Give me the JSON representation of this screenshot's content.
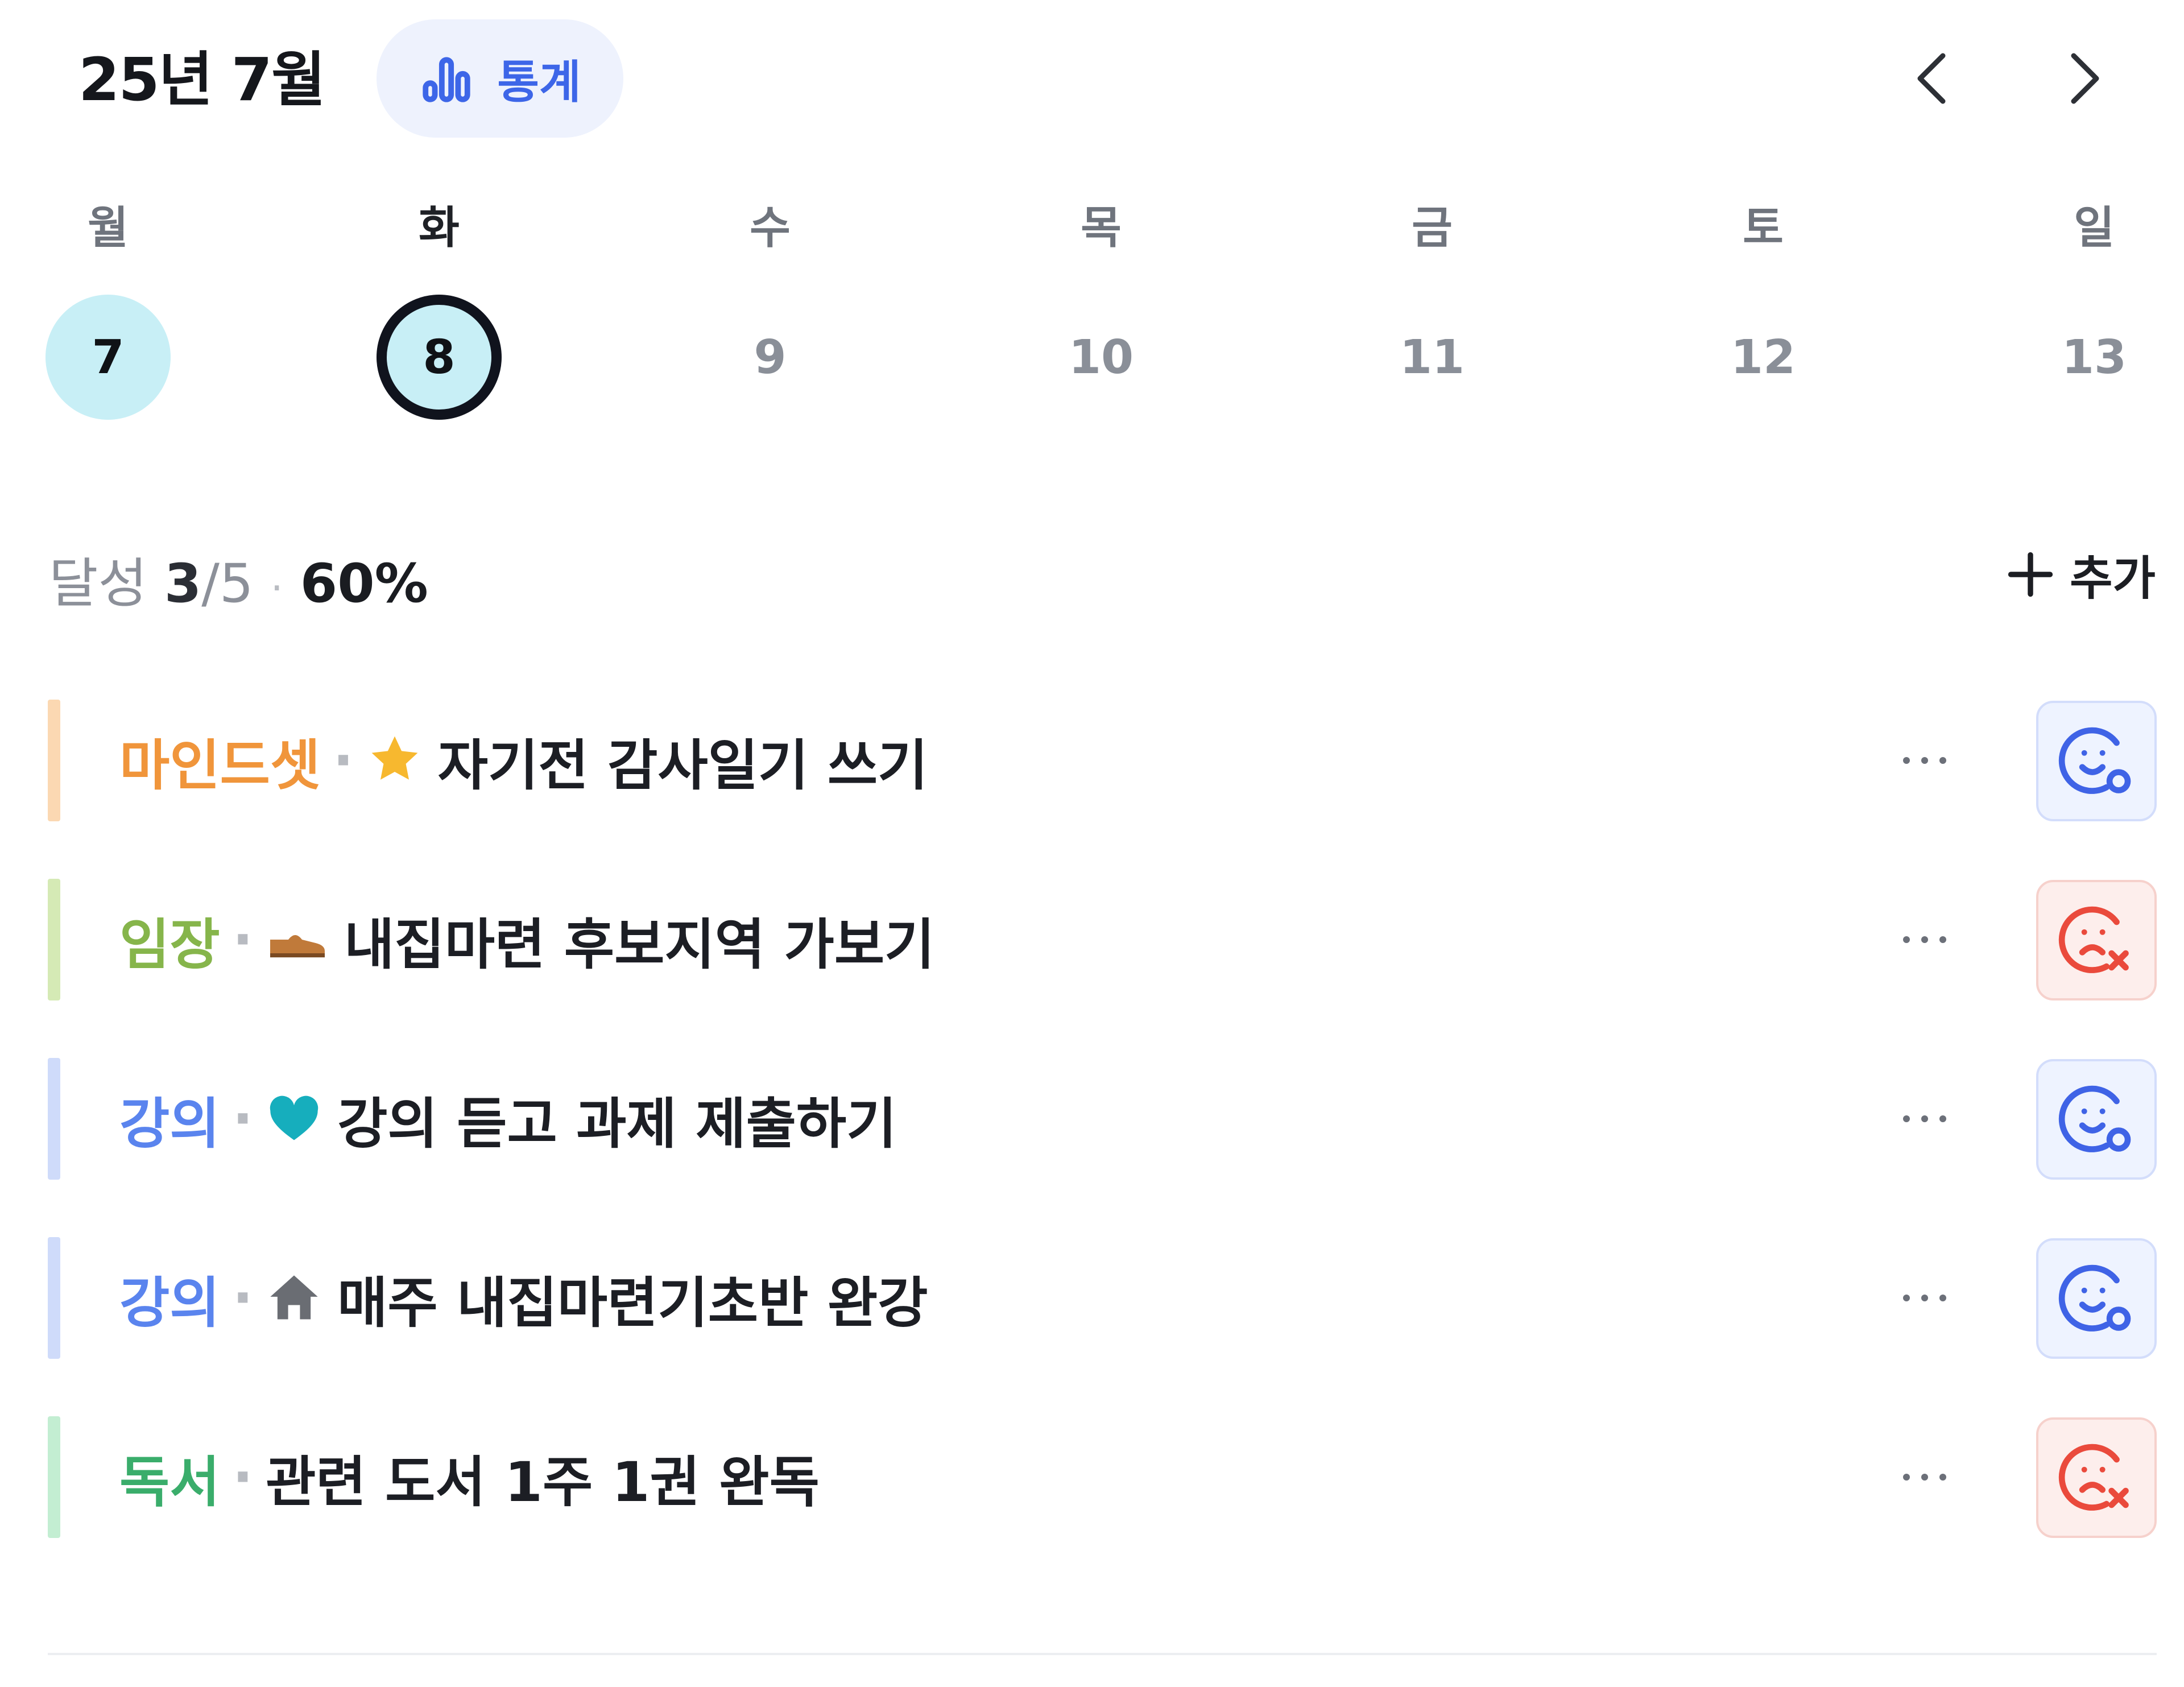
{
  "header": {
    "title": "25년 7월",
    "stats_label": "통계",
    "stats_icon": "bar-chart-icon",
    "prev_icon": "chevron-left-icon",
    "next_icon": "chevron-right-icon"
  },
  "week": {
    "days": [
      {
        "dow": "월",
        "date": "7",
        "state": "done"
      },
      {
        "dow": "화",
        "date": "8",
        "state": "selected"
      },
      {
        "dow": "수",
        "date": "9",
        "state": "default"
      },
      {
        "dow": "목",
        "date": "10",
        "state": "default"
      },
      {
        "dow": "금",
        "date": "11",
        "state": "default"
      },
      {
        "dow": "토",
        "date": "12",
        "state": "default"
      },
      {
        "dow": "일",
        "date": "13",
        "state": "default"
      }
    ]
  },
  "progress": {
    "label": "달성",
    "done": "3",
    "total": "/5",
    "separator": "·",
    "percent": "60%"
  },
  "add_button": {
    "label": "추가",
    "icon": "plus-icon"
  },
  "habits": [
    {
      "category": "마인드셋",
      "emoji": "star-icon",
      "title": "자기전 감사일기 쓰기",
      "status": "success",
      "category_color": "#f0953b",
      "bar_color": "#fbd8b2"
    },
    {
      "category": "임장",
      "emoji": "shoe-icon",
      "title": "내집마련 후보지역 가보기",
      "status": "fail",
      "category_color": "#86b54b",
      "bar_color": "#d5eab5"
    },
    {
      "category": "강의",
      "emoji": "heart-icon",
      "title": "강의 듣고 과제 제출하기",
      "status": "success",
      "category_color": "#5a84ee",
      "bar_color": "#cfdbfa"
    },
    {
      "category": "강의",
      "emoji": "house-icon",
      "title": "매주 내집마련기초반 완강",
      "status": "success",
      "category_color": "#5a84ee",
      "bar_color": "#cfdbfa"
    },
    {
      "category": "독서",
      "emoji": "",
      "title": "관련 도서 1주 1권 완독",
      "status": "fail",
      "category_color": "#3aad6b",
      "bar_color": "#c3eed2"
    }
  ],
  "colors": {
    "accent_blue": "#3d66e8",
    "success_icon": "#3f63e6",
    "fail_icon": "#ea4a3c",
    "selected_ring": "#10131d",
    "done_fill": "#c8eff6"
  }
}
